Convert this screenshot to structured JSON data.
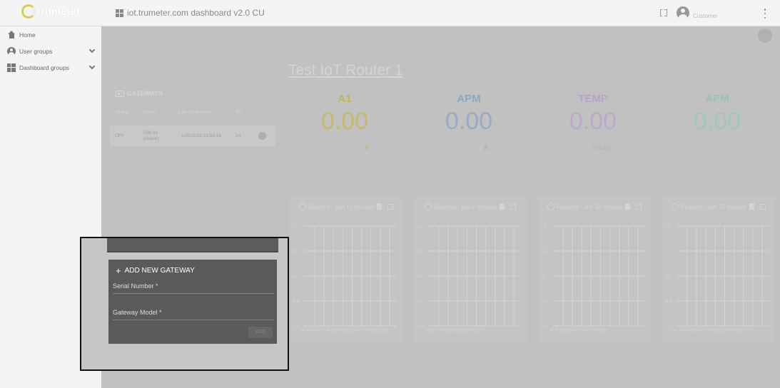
{
  "header": {
    "logo_text": "trumeter",
    "dashboard_title": "iot.trumeter.com dashboard v2.0 CU",
    "user_name": "Customer"
  },
  "sidebar": {
    "items": [
      {
        "label": "Home",
        "icon": "home-icon"
      },
      {
        "label": "User groups",
        "icon": "account-circle-icon"
      },
      {
        "label": "Dashboard groups",
        "icon": "dashboard-icon"
      }
    ]
  },
  "dashboard": {
    "title": "Test IoT Router 1",
    "more_button": "···"
  },
  "gateways": {
    "heading": "GATEWAYS",
    "columns": [
      "Status",
      "Name",
      "Last Time Active",
      "Tel"
    ],
    "rows": [
      {
        "status": "OFF",
        "name": "GW 01 (Gawe)",
        "last_active": "1/08/2022 21:59:18",
        "tel": "24"
      }
    ]
  },
  "values": [
    {
      "label": "A1",
      "value": "0.00",
      "unit": "V",
      "color": "#e6d86a"
    },
    {
      "label": "APM",
      "value": "0.00",
      "unit": "A",
      "color": "#a9c6e8"
    },
    {
      "label": "TEMP",
      "value": "0.00",
      "unit": "Celcius",
      "color": "#d9c4ef"
    },
    {
      "label": "APM",
      "value": "0.00",
      "unit": "V",
      "color": "#b6ecd8"
    }
  ],
  "charts": [
    {
      "title": "Realtime - last 15 minutes",
      "y_ticks": [
        "1.0",
        "0.5",
        "0.0",
        "-0.5",
        "-1.0"
      ],
      "x_ticks": "09:44 09:46 09:48 09:50 09:52 09:54 09:56 09:58 10:00"
    },
    {
      "title": "Realtime - last 2 minutes",
      "y_ticks": [
        "1.0",
        "0.5",
        "0.0",
        "-0.5",
        "-1.0"
      ],
      "x_ticks": "09:58:00   09:58:30   09:59:00   09:59:30"
    },
    {
      "title": "Realtime - last 30 minutes",
      "y_ticks": [
        "1.0",
        "0.5",
        "0.0",
        "-0.5",
        "-1.0"
      ],
      "x_ticks": "09:30   09:35   09:40   09:45   09:50   09:55"
    },
    {
      "title": "Realtime - last 15 minutes",
      "y_ticks": [
        "1.0",
        "0.5",
        "0.0",
        "-0.5",
        "-1.0"
      ],
      "x_ticks": "09:44 09:46 09:48 09:50 09:52 09:54 09:56 09:58"
    }
  ],
  "add_gateway": {
    "title": "ADD NEW GATEWAY",
    "serial_label": "Serial Number *",
    "model_label": "Gateway Model *",
    "add_button": "ADD"
  }
}
